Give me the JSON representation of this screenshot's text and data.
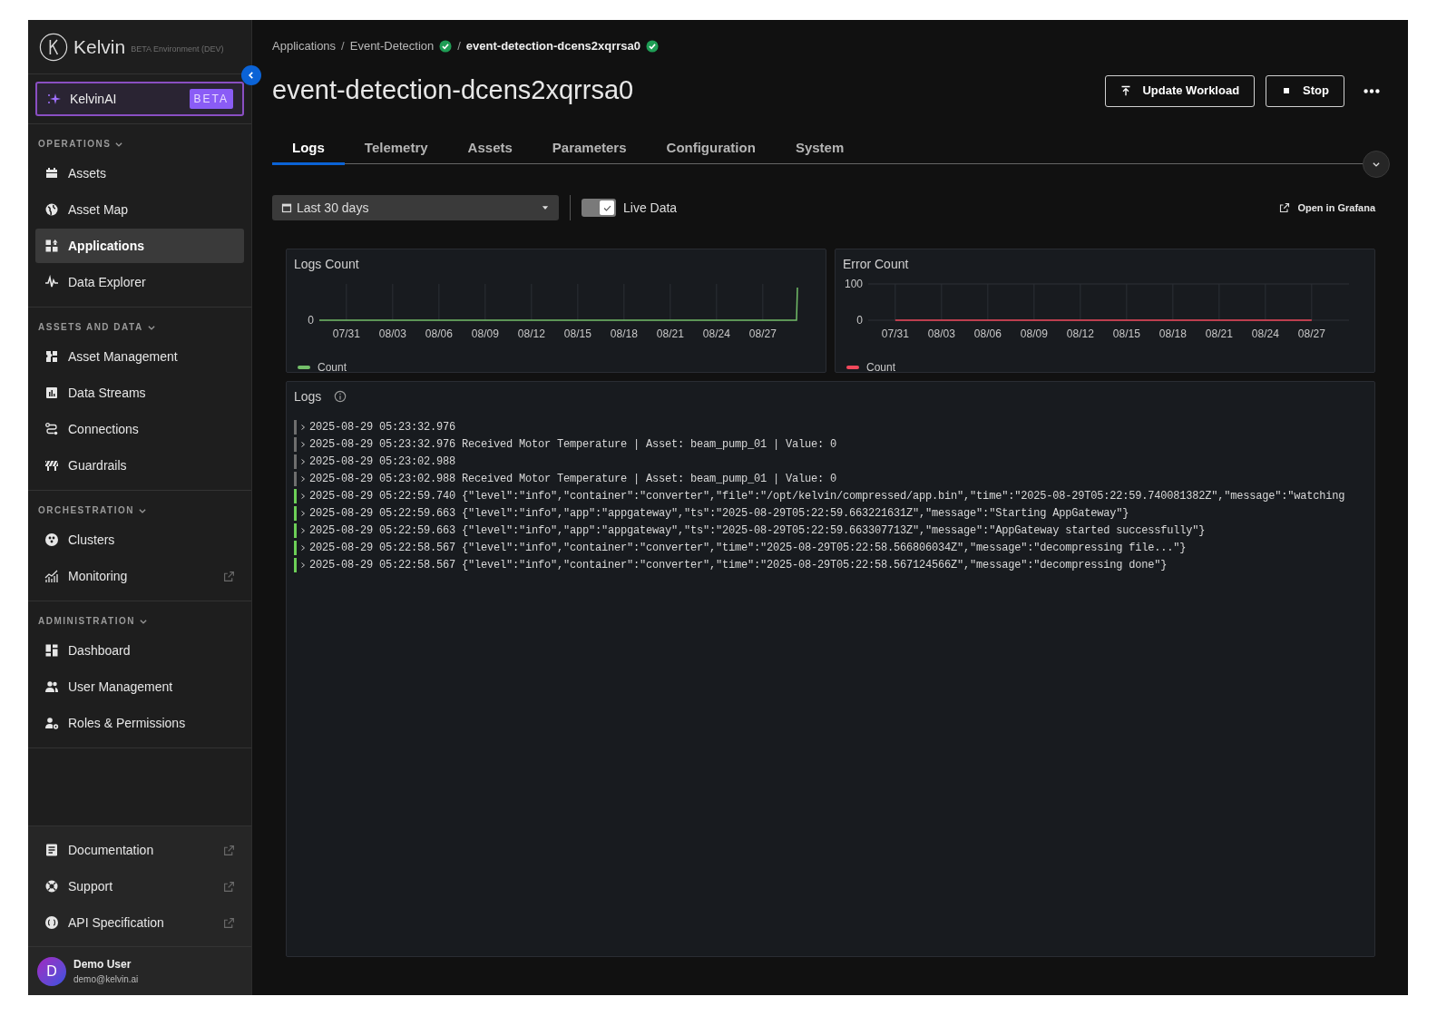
{
  "sidebar": {
    "logo": "Kelvin",
    "environment": "BETA Environment (DEV)",
    "ai_button": {
      "label": "KelvinAI",
      "badge": "BETA"
    },
    "sections": [
      {
        "title": "OPERATIONS",
        "expanded": true,
        "items": [
          {
            "label": "Assets",
            "selected": false
          },
          {
            "label": "Asset Map",
            "selected": false
          },
          {
            "label": "Applications",
            "selected": true
          },
          {
            "label": "Data Explorer",
            "selected": false
          }
        ]
      },
      {
        "title": "ASSETS AND DATA",
        "expanded": true,
        "items": [
          {
            "label": "Asset Management",
            "selected": false
          },
          {
            "label": "Data Streams",
            "selected": false
          },
          {
            "label": "Connections",
            "selected": false
          },
          {
            "label": "Guardrails",
            "selected": false
          }
        ]
      },
      {
        "title": "ORCHESTRATION",
        "expanded": true,
        "items": [
          {
            "label": "Clusters",
            "selected": false
          },
          {
            "label": "Monitoring",
            "selected": false,
            "external": true
          }
        ]
      },
      {
        "title": "ADMINISTRATION",
        "expanded": true,
        "items": [
          {
            "label": "Dashboard",
            "selected": false
          },
          {
            "label": "User Management",
            "selected": false
          },
          {
            "label": "Roles & Permissions",
            "selected": false
          }
        ]
      }
    ],
    "footer_links": [
      {
        "label": "Documentation",
        "external": true
      },
      {
        "label": "Support",
        "external": true
      },
      {
        "label": "API Specification",
        "external": true
      }
    ],
    "user": {
      "initial": "D",
      "name": "Demo User",
      "email": "demo@kelvin.ai"
    }
  },
  "breadcrumb": [
    {
      "label": "Applications",
      "current": false
    },
    {
      "separator": "/",
      "label": "Event-Detection",
      "verified": true,
      "current": false
    },
    {
      "separator": "/",
      "label": "event-detection-dcens2xqrrsa0",
      "verified": true,
      "current": true
    }
  ],
  "title": "event-detection-dcens2xqrrsa0",
  "actions": [
    "Update Workload",
    "Stop"
  ],
  "tabs": [
    {
      "label": "Logs",
      "selected": true
    },
    {
      "label": "Telemetry",
      "selected": false
    },
    {
      "label": "Assets",
      "selected": false
    },
    {
      "label": "Parameters",
      "selected": false
    },
    {
      "label": "Configuration",
      "selected": false
    },
    {
      "label": "System",
      "selected": false
    }
  ],
  "toolbar": {
    "time_range": "Last 30 days",
    "live_data": {
      "label": "Live Data",
      "on": true
    },
    "grafana_link": "Open in Grafana"
  },
  "logs_count_panel": {
    "title": "Logs Count",
    "y_tick": "0",
    "x_labels": [
      "07/31",
      "08/03",
      "08/06",
      "08/09",
      "08/12",
      "08/15",
      "08/18",
      "08/21",
      "08/24",
      "08/27"
    ],
    "legend": "Count"
  },
  "error_count_panel": {
    "title": "Error Count",
    "chart_data": {
      "type": "line",
      "categories": [
        "07/31",
        "08/03",
        "08/06",
        "08/09",
        "08/12",
        "08/15",
        "08/18",
        "08/21",
        "08/24",
        "08/27"
      ],
      "series": [
        {
          "name": "Count",
          "color": "#f2495c",
          "values": [
            0,
            0,
            0,
            0,
            0,
            0,
            0,
            0,
            0,
            0
          ]
        }
      ],
      "ylim": [
        0,
        100
      ],
      "yticks": [
        0,
        100
      ],
      "grid": true
    }
  },
  "logs_panel": {
    "title": "Logs",
    "rows": [
      {
        "text": "2025-08-29 05:23:32.976",
        "color": "#6e6e6e"
      },
      {
        "text": "2025-08-29 05:23:32.976 Received Motor Temperature | Asset: beam_pump_01 | Value: 0",
        "color": "#6e6e6e"
      },
      {
        "text": "2025-08-29 05:23:02.988",
        "color": "#6e6e6e"
      },
      {
        "text": "2025-08-29 05:23:02.988 Received Motor Temperature | Asset: beam_pump_01 | Value: 0",
        "color": "#6e6e6e"
      },
      {
        "text": "2025-08-29 05:22:59.740 {\"level\":\"info\",\"container\":\"converter\",\"file\":\"/opt/kelvin/compressed/app.bin\",\"time\":\"2025-08-29T05:22:59.740081382Z\",\"message\":\"watching",
        "color": "#6ccf57"
      },
      {
        "text": "2025-08-29 05:22:59.663 {\"level\":\"info\",\"app\":\"appgateway\",\"ts\":\"2025-08-29T05:22:59.663221631Z\",\"message\":\"Starting AppGateway\"}",
        "color": "#6ccf57"
      },
      {
        "text": "2025-08-29 05:22:59.663 {\"level\":\"info\",\"app\":\"appgateway\",\"ts\":\"2025-08-29T05:22:59.663307713Z\",\"message\":\"AppGateway started successfully\"}",
        "color": "#6ccf57"
      },
      {
        "text": "2025-08-29 05:22:58.567 {\"level\":\"info\",\"container\":\"converter\",\"time\":\"2025-08-29T05:22:58.566806034Z\",\"message\":\"decompressing file...\"}",
        "color": "#6ccf57"
      },
      {
        "text": "2025-08-29 05:22:58.567 {\"level\":\"info\",\"container\":\"converter\",\"time\":\"2025-08-29T05:22:58.567124566Z\",\"message\":\"decompressing done\"}",
        "color": "#6ccf57"
      }
    ]
  }
}
